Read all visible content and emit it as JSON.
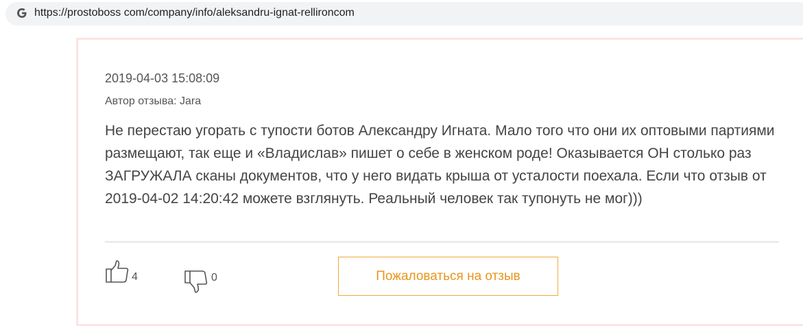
{
  "browser": {
    "url": "https://prostoboss com/company/info/aleksandru-ignat-rellironcom",
    "favicon": "google-g-icon"
  },
  "review": {
    "date": "2019-04-03 15:08:09",
    "author_line": "Автор отзыва: Jara",
    "text": "Не перестаю угорать с тупости ботов Александру Игната. Мало того что они их оптовыми партиями размещают, так еще и «Владислав» пишет о себе в женском роде! Оказывается ОН столько раз ЗАГРУЖАЛА сканы документов, что у него видать крыша от усталости поехала. Если что отзыв от 2019-04-02 14:20:42 можете взглянуть. Реальный человек так тупонуть не мог)))",
    "likes": "4",
    "dislikes": "0",
    "like_icon": "thumbs-up-icon",
    "dislike_icon": "thumbs-down-icon",
    "complain_label": "Пожаловаться на отзыв"
  },
  "colors": {
    "card_border": "#fde3e3",
    "accent_orange": "#e8951c",
    "text": "#444444"
  }
}
